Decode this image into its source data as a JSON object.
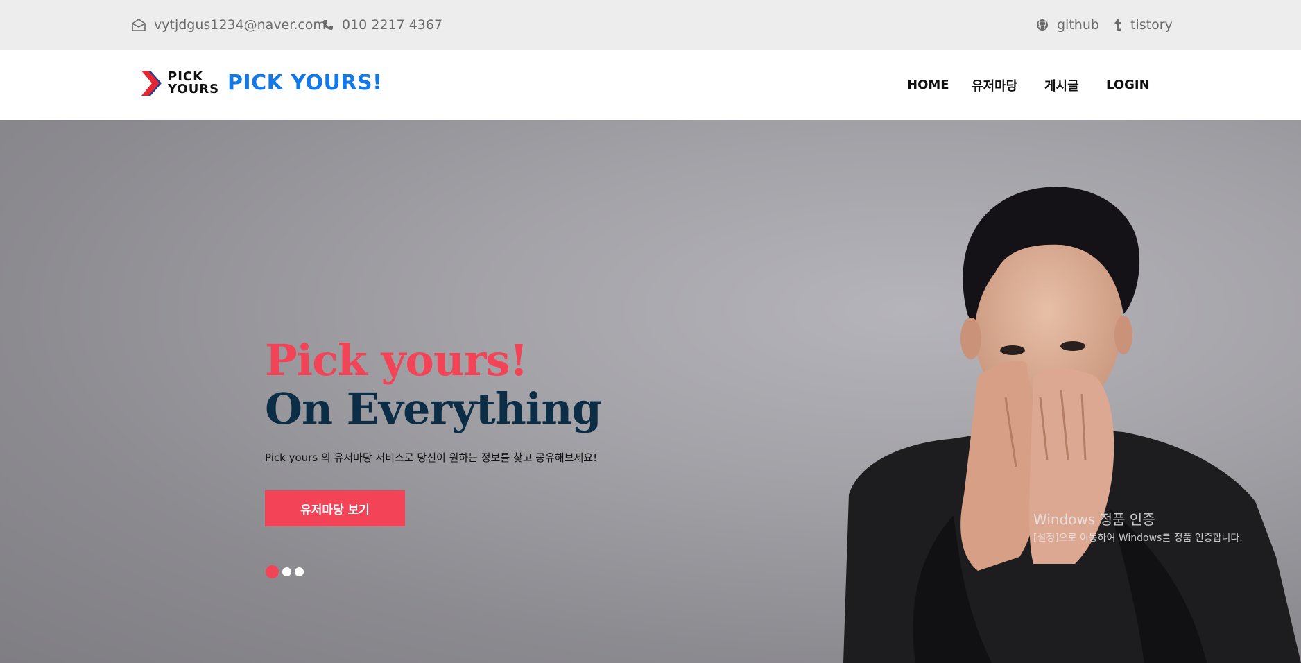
{
  "topbar": {
    "email": "vytjdgus1234@naver.com",
    "phone": "010 2217 4367",
    "github": "github",
    "tistory": "tistory",
    "icons": {
      "email": "envelope-open-icon",
      "phone": "phone-icon",
      "github": "github-icon",
      "tistory": "tumblr-t-icon"
    }
  },
  "header": {
    "logo_line1": "PICK",
    "logo_line2": "YOURS",
    "brand": "PICK YOURS!",
    "nav": [
      "HOME",
      "유저마당",
      "게시글",
      "LOGIN"
    ]
  },
  "hero": {
    "title_line1": "Pick yours!",
    "title_line2": "On Everything",
    "subtitle": "Pick yours 의 유저마당 서비스로 당신이 원하는 정보를 찾고 공유해보세요!",
    "button": "유저마당 보기",
    "slides": 3,
    "active_slide": 1
  },
  "watermark": {
    "line1": "Windows 정품 인증",
    "line2": "[설정]으로 이동하여 Windows를 정품 인증합니다."
  },
  "colors": {
    "accent_red": "#f24456",
    "brand_blue": "#1378e8",
    "title_navy": "#0b2d45",
    "topbar_bg": "#ededed"
  }
}
